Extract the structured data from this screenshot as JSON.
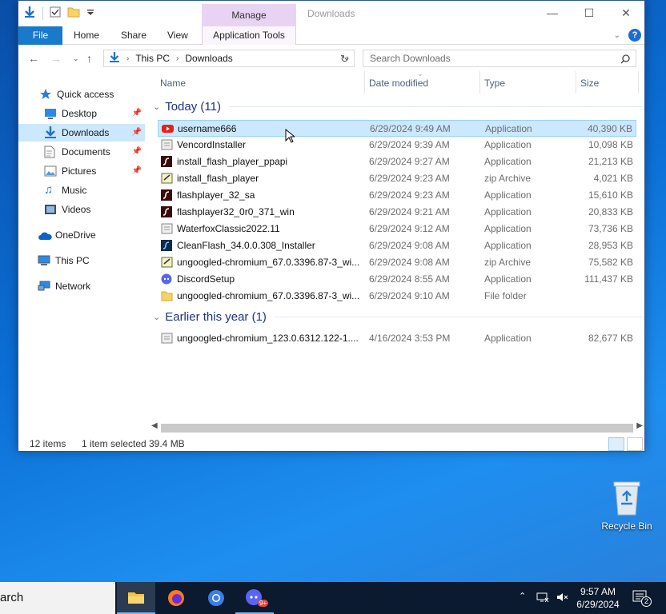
{
  "window": {
    "title": "Downloads",
    "manage_tab": "Manage",
    "controls": {
      "minimize": "—",
      "maximize": "☐",
      "close": "✕"
    }
  },
  "ribbon": {
    "tabs": [
      "File",
      "Home",
      "Share",
      "View",
      "Application Tools"
    ],
    "help": "?"
  },
  "address": {
    "path": [
      "This PC",
      "Downloads"
    ],
    "search_placeholder": "Search Downloads"
  },
  "nav": {
    "items": [
      {
        "label": "Quick access"
      },
      {
        "label": "Desktop",
        "pinned": true
      },
      {
        "label": "Downloads",
        "pinned": true,
        "selected": true
      },
      {
        "label": "Documents",
        "pinned": true
      },
      {
        "label": "Pictures",
        "pinned": true
      },
      {
        "label": "Music"
      },
      {
        "label": "Videos"
      },
      {
        "label": "OneDrive"
      },
      {
        "label": "This PC"
      },
      {
        "label": "Network"
      }
    ]
  },
  "columns": {
    "name": "Name",
    "date": "Date modified",
    "type": "Type",
    "size": "Size"
  },
  "groups": [
    {
      "label": "Today (11)",
      "files": [
        {
          "name": "username666",
          "date": "6/29/2024 9:49 AM",
          "type": "Application",
          "size": "40,390 KB",
          "icon": "youtube-icon",
          "selected": true
        },
        {
          "name": "VencordInstaller",
          "date": "6/29/2024 9:39 AM",
          "type": "Application",
          "size": "10,098 KB",
          "icon": "installer-icon"
        },
        {
          "name": "install_flash_player_ppapi",
          "date": "6/29/2024 9:27 AM",
          "type": "Application",
          "size": "21,213 KB",
          "icon": "flash-icon"
        },
        {
          "name": "install_flash_player",
          "date": "6/29/2024 9:23 AM",
          "type": "zip Archive",
          "size": "4,021 KB",
          "icon": "zip-icon"
        },
        {
          "name": "flashplayer_32_sa",
          "date": "6/29/2024 9:23 AM",
          "type": "Application",
          "size": "15,610 KB",
          "icon": "flash-icon"
        },
        {
          "name": "flashplayer32_0r0_371_win",
          "date": "6/29/2024 9:21 AM",
          "type": "Application",
          "size": "20,833 KB",
          "icon": "flash-icon"
        },
        {
          "name": "WaterfoxClassic2022.11",
          "date": "6/29/2024 9:12 AM",
          "type": "Application",
          "size": "73,736 KB",
          "icon": "installer-icon"
        },
        {
          "name": "CleanFlash_34.0.0.308_Installer",
          "date": "6/29/2024 9:08 AM",
          "type": "Application",
          "size": "28,953 KB",
          "icon": "cleanflash-icon"
        },
        {
          "name": "ungoogled-chromium_67.0.3396.87-3_wi...",
          "date": "6/29/2024 9:08 AM",
          "type": "zip Archive",
          "size": "75,582 KB",
          "icon": "zip-icon"
        },
        {
          "name": "DiscordSetup",
          "date": "6/29/2024 8:55 AM",
          "type": "Application",
          "size": "111,437 KB",
          "icon": "discord-icon"
        },
        {
          "name": "ungoogled-chromium_67.0.3396.87-3_wi...",
          "date": "6/29/2024 9:10 AM",
          "type": "File folder",
          "size": "",
          "icon": "folder-icon"
        }
      ]
    },
    {
      "label": "Earlier this year (1)",
      "files": [
        {
          "name": "ungoogled-chromium_123.0.6312.122-1....",
          "date": "4/16/2024 3:53 PM",
          "type": "Application",
          "size": "82,677 KB",
          "icon": "installer-icon"
        }
      ]
    }
  ],
  "status": {
    "items": "12 items",
    "selected": "1 item selected",
    "size": "39.4 MB"
  },
  "desktop": {
    "recycle_bin": "Recycle Bin"
  },
  "taskbar": {
    "search_text": "arch",
    "time": "9:57 AM",
    "date": "6/29/2024",
    "notification_count": "2",
    "discord_badge": "9+"
  },
  "colors": {
    "accent": "#1979ca",
    "selection": "#cce8ff",
    "manage": "#e9d3f3"
  }
}
